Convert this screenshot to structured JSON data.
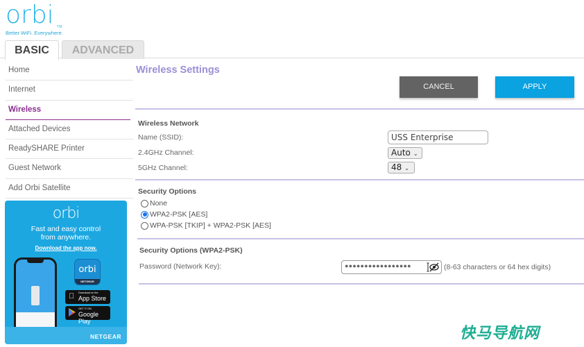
{
  "brand": {
    "logo_word": "orbi",
    "logo_tm": "TM",
    "tagline": "Better WiFi. Everywhere."
  },
  "tabs": [
    {
      "label": "BASIC",
      "active": true
    },
    {
      "label": "ADVANCED",
      "active": false
    }
  ],
  "sidebar": {
    "items": [
      {
        "label": "Home"
      },
      {
        "label": "Internet"
      },
      {
        "label": "Wireless",
        "active": true
      },
      {
        "label": "Attached Devices"
      },
      {
        "label": "ReadySHARE Printer"
      },
      {
        "label": "Guest Network"
      },
      {
        "label": "Add Orbi Satellite"
      }
    ]
  },
  "promo": {
    "logo_word": "orbi",
    "text_line1": "Fast and easy control",
    "text_line2": "from anywhere.",
    "link": "Download the app now.",
    "app_icon_word": "orbi",
    "app_icon_band": "NETGEAR",
    "appstore_small": "Download on the",
    "appstore_big": "App Store",
    "google_small": "GET IT ON",
    "google_big": "Google Play",
    "brand": "NETGEAR"
  },
  "main": {
    "title": "Wireless Settings",
    "cancel_label": "CANCEL",
    "apply_label": "APPLY",
    "wireless_network": {
      "heading": "Wireless Network",
      "ssid_label": "Name (SSID):",
      "ssid_value": "USS Enterprise",
      "ch24_label": "2.4GHz Channel:",
      "ch24_value": "Auto",
      "ch5_label": "5GHz Channel:",
      "ch5_value": "48"
    },
    "security_options": {
      "heading": "Security Options",
      "options": [
        {
          "label": "None",
          "checked": false
        },
        {
          "label": "WPA2-PSK [AES]",
          "checked": true
        },
        {
          "label": "WPA-PSK [TKIP] + WPA2-PSK [AES]",
          "checked": false
        }
      ]
    },
    "security_wpa2": {
      "heading": "Security Options (WPA2-PSK)",
      "password_label": "Password (Network Key):",
      "password_mask": "●●●●●●●●●●●●●●●●●",
      "password_hint": "(8-63 characters or 64 hex digits)"
    }
  },
  "watermark": "快马导航网"
}
